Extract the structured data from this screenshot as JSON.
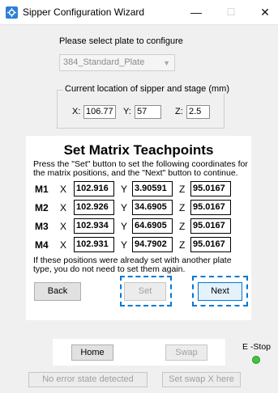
{
  "window": {
    "title": "Sipper Configuration Wizard",
    "minimize_glyph": "—",
    "maximize_glyph": "☐",
    "close_glyph": "✕"
  },
  "plate_select": {
    "prompt": "Please select plate to configure",
    "selected": "384_Standard_Plate"
  },
  "location": {
    "legend": "Current location of sipper and stage (mm)",
    "x_label": "X:",
    "x_value": "106.77",
    "y_label": "Y:",
    "y_value": "57",
    "z_label": "Z:",
    "z_value": "2.5"
  },
  "teachpoints": {
    "title": "Set Matrix Teachpoints",
    "instructions": "Press the \"Set\" button to set the following coordinates for the matrix positions, and the \"Next\" button to continue.",
    "rows": [
      {
        "name": "M1",
        "x_label": "X",
        "x": "102.916",
        "y_label": "Y",
        "y": "3.90591",
        "z_label": "Z",
        "z": "95.0167"
      },
      {
        "name": "M2",
        "x_label": "X",
        "x": "102.926",
        "y_label": "Y",
        "y": "34.6905",
        "z_label": "Z",
        "z": "95.0167"
      },
      {
        "name": "M3",
        "x_label": "X",
        "x": "102.934",
        "y_label": "Y",
        "y": "64.6905",
        "z_label": "Z",
        "z": "95.0167"
      },
      {
        "name": "M4",
        "x_label": "X",
        "x": "102.931",
        "y_label": "Y",
        "y": "94.7902",
        "z_label": "Z",
        "z": "95.0167"
      }
    ],
    "note": "If these positions were already set with another plate type, you do not need to set them again."
  },
  "nav": {
    "back_label": "Back",
    "set_label": "Set",
    "next_label": "Next"
  },
  "footer": {
    "home_label": "Home",
    "swap_label": "Swap",
    "estop_label": "E -Stop",
    "estop_color": "#3ec63e",
    "error_state_label": "No error state detected",
    "set_swap_label": "Set swap X here"
  }
}
